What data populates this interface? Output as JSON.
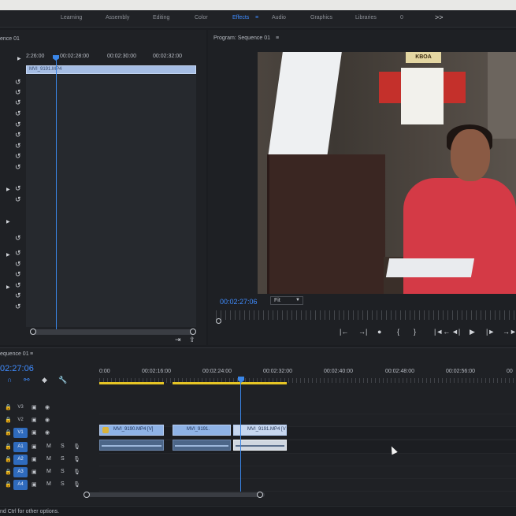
{
  "workspaces": {
    "tabs": [
      "Learning",
      "Assembly",
      "Editing",
      "Color",
      "Effects",
      "Audio",
      "Graphics",
      "Libraries",
      "0"
    ],
    "active": "Effects",
    "more_icon": ">>"
  },
  "source_panel": {
    "title": "ence 01",
    "ruler_labels": [
      "2:26:00",
      "00:02:28:00",
      "00:02:30:00",
      "00:02:32:00"
    ],
    "clip_name": "MVI_9191.MP4"
  },
  "program_panel": {
    "title": "Program: Sequence 01",
    "menu_icon": "≡",
    "timecode": "00:02:27:06",
    "zoom": "Fit",
    "transport": [
      "|←",
      "→|",
      "●",
      "{",
      "}",
      "|◄←",
      "◄|",
      "▶",
      "|►",
      "→►"
    ],
    "video_sign": "KBOA"
  },
  "timeline": {
    "title": "equence 01",
    "timecode": "02:27:06",
    "ruler_labels": [
      "0:00",
      "00:02:16:00",
      "00:02:24:00",
      "00:02:32:00",
      "00:02:40:00",
      "00:02:48:00",
      "00:02:56:00",
      "00"
    ],
    "video_tracks": [
      "V3",
      "V2",
      "V1"
    ],
    "audio_tracks": [
      "A1",
      "A2",
      "A3",
      "A4"
    ],
    "clips": {
      "v1_a": "MVI_9190.MP4 [V]",
      "v1_b": "MVI_9191.",
      "v1_c": "MVI_9191.MP4 [V"
    },
    "mute": "M",
    "solo": "S"
  },
  "status_bar": {
    "text": "nd Ctrl for other options."
  },
  "colors": {
    "accent": "#3f8cff",
    "clip_video": "#8fb3e6",
    "clip_audio": "#4c6688",
    "work_area": "#e6c525"
  }
}
